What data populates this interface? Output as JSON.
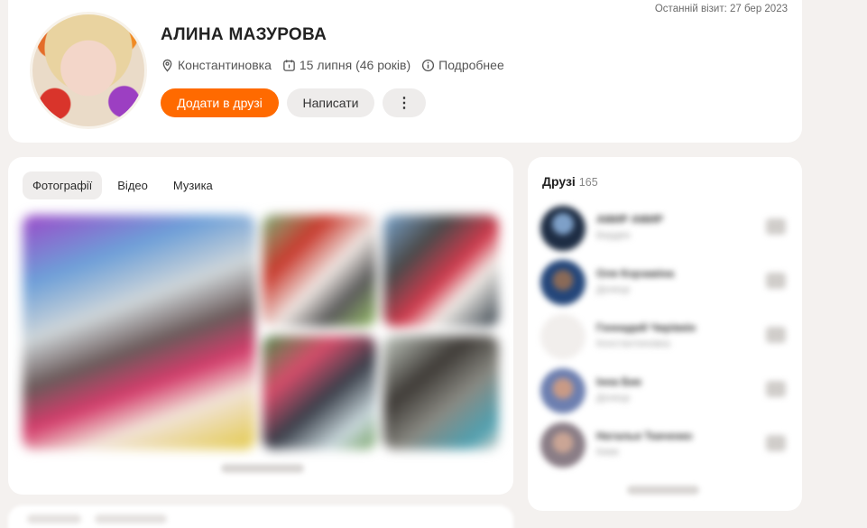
{
  "profile": {
    "name": "АЛИНА МАЗУРОВА",
    "last_visit": "Останній візит: 27 бер 2023",
    "city": "Константиновка",
    "birthday": "15 липня (46 років)",
    "details_label": "Подробнее",
    "add_friend_label": "Додати в друзі",
    "message_label": "Написати",
    "more_label": "⋮"
  },
  "media": {
    "tabs": [
      "Фотографії",
      "Відео",
      "Музика"
    ],
    "active_tab": 0
  },
  "friends": {
    "title": "Друзі",
    "count": "165",
    "items": [
      {
        "name": "АМИР АМИР",
        "sub": "Бердян"
      },
      {
        "name": "Оля Корзавіна",
        "sub": "Донецк"
      },
      {
        "name": "Геннадий Чирівкін",
        "sub": "Константиновка"
      },
      {
        "name": "Інна Бик",
        "sub": "Донецк"
      },
      {
        "name": "Наталья Ткаченко",
        "sub": "Киев"
      }
    ]
  },
  "colors": {
    "accent": "#ff6a00",
    "background": "#f4f1ef",
    "card": "#ffffff"
  }
}
